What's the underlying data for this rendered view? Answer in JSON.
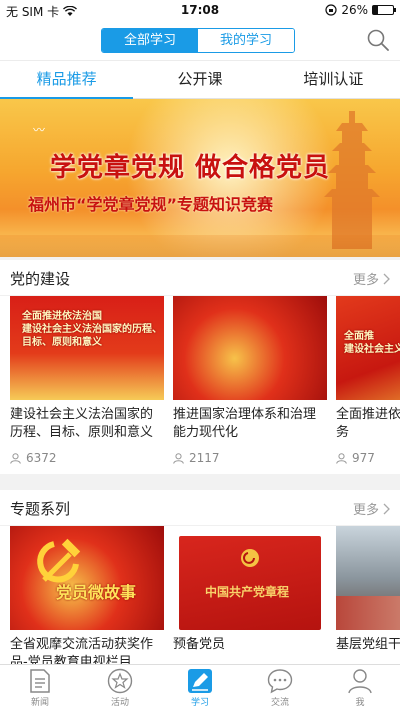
{
  "status_bar": {
    "carrier": "无 SIM 卡",
    "time": "17:08",
    "battery": "26%",
    "battery_level": 0.26
  },
  "header": {
    "segments": [
      "全部学习",
      "我的学习"
    ],
    "active_segment": 0
  },
  "tabs": [
    "精品推荐",
    "公开课",
    "培训认证"
  ],
  "banner": {
    "line1": "学党章党规 做合格党员",
    "line2": "福州市“学党章党规”专题知识竞赛"
  },
  "sections": [
    {
      "title": "党的建设",
      "more": "更多",
      "cards": [
        {
          "title": "建设社会主义法治国家的历程、目标、原则和意义",
          "views": "6372",
          "thumb_text": "全面推进依法治国\n建设社会主义法治国家的历程、\n目标、原则和意义"
        },
        {
          "title": "推进国家治理体系和治理能力现代化",
          "views": "2117",
          "thumb_text": ""
        },
        {
          "title": "全面推进依法治国的总任务",
          "views": "977",
          "thumb_text": "全面推\n建设社会主义"
        }
      ]
    },
    {
      "title": "专题系列",
      "more": "更多",
      "cards": [
        {
          "title": "全省观摩交流活动获奖作品-党员教育电视栏目...",
          "thumb_text": "党员微故事"
        },
        {
          "title": "预备党员",
          "thumb_text": "中国共产党章程"
        },
        {
          "title": "基层党组干",
          "thumb_text": ""
        }
      ]
    }
  ],
  "bottom_nav": [
    {
      "label": "新闻",
      "icon": "news-icon"
    },
    {
      "label": "活动",
      "icon": "star-icon"
    },
    {
      "label": "学习",
      "icon": "study-icon",
      "active": true
    },
    {
      "label": "交流",
      "icon": "chat-icon"
    },
    {
      "label": "我",
      "icon": "person-icon"
    }
  ],
  "colors": {
    "accent": "#1a9be6",
    "party_red": "#c8110f"
  }
}
